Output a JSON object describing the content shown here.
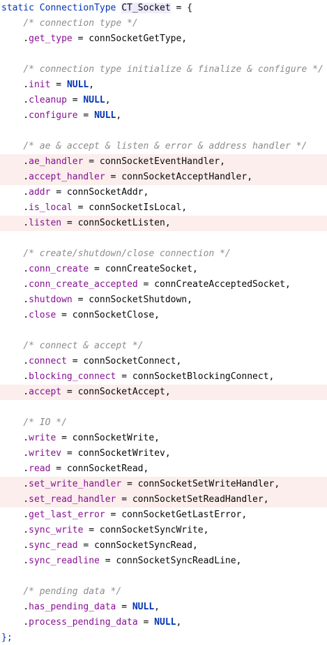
{
  "colors": {
    "background": "#ffffff",
    "highlight_line": "#fbeeec",
    "keyword": "#0033b3",
    "comment": "#8c8c8c",
    "field": "#871094",
    "text": "#080808"
  },
  "lines": [
    {
      "hl": false,
      "tokens": [
        {
          "t": "static ",
          "c": "kw"
        },
        {
          "t": "ConnectionType ",
          "c": "kw"
        },
        {
          "t": "CT_Socket",
          "c": "hl-word"
        },
        {
          "t": " = {",
          "c": "punct"
        }
      ]
    },
    {
      "hl": false,
      "tokens": [
        {
          "t": "    ",
          "c": "punct"
        },
        {
          "t": "/* connection type */",
          "c": "comment"
        }
      ]
    },
    {
      "hl": false,
      "tokens": [
        {
          "t": "    .",
          "c": "punct"
        },
        {
          "t": "get_type",
          "c": "field"
        },
        {
          "t": " = connSocketGetType,",
          "c": "ident"
        }
      ]
    },
    {
      "hl": false,
      "tokens": []
    },
    {
      "hl": false,
      "tokens": [
        {
          "t": "    ",
          "c": "punct"
        },
        {
          "t": "/* connection type initialize & finalize & configure */",
          "c": "comment"
        }
      ]
    },
    {
      "hl": false,
      "tokens": [
        {
          "t": "    .",
          "c": "punct"
        },
        {
          "t": "init",
          "c": "field"
        },
        {
          "t": " = ",
          "c": "ident"
        },
        {
          "t": "NULL",
          "c": "null-kw"
        },
        {
          "t": ",",
          "c": "punct"
        }
      ]
    },
    {
      "hl": false,
      "tokens": [
        {
          "t": "    .",
          "c": "punct"
        },
        {
          "t": "cleanup",
          "c": "field"
        },
        {
          "t": " = ",
          "c": "ident"
        },
        {
          "t": "NULL",
          "c": "null-kw"
        },
        {
          "t": ",",
          "c": "punct"
        }
      ]
    },
    {
      "hl": false,
      "tokens": [
        {
          "t": "    .",
          "c": "punct"
        },
        {
          "t": "configure",
          "c": "field"
        },
        {
          "t": " = ",
          "c": "ident"
        },
        {
          "t": "NULL",
          "c": "null-kw"
        },
        {
          "t": ",",
          "c": "punct"
        }
      ]
    },
    {
      "hl": false,
      "tokens": []
    },
    {
      "hl": false,
      "tokens": [
        {
          "t": "    ",
          "c": "punct"
        },
        {
          "t": "/* ae & accept & listen & error & address handler */",
          "c": "comment"
        }
      ]
    },
    {
      "hl": true,
      "tokens": [
        {
          "t": "    .",
          "c": "punct"
        },
        {
          "t": "ae_handler",
          "c": "field"
        },
        {
          "t": " = connSocketEventHandler,",
          "c": "ident"
        }
      ]
    },
    {
      "hl": true,
      "tokens": [
        {
          "t": "    .",
          "c": "punct"
        },
        {
          "t": "accept_handler",
          "c": "field"
        },
        {
          "t": " = connSocketAcceptHandler,",
          "c": "ident"
        }
      ]
    },
    {
      "hl": false,
      "tokens": [
        {
          "t": "    .",
          "c": "punct"
        },
        {
          "t": "addr",
          "c": "field"
        },
        {
          "t": " = connSocketAddr,",
          "c": "ident"
        }
      ]
    },
    {
      "hl": false,
      "tokens": [
        {
          "t": "    .",
          "c": "punct"
        },
        {
          "t": "is_local",
          "c": "field"
        },
        {
          "t": " = connSocketIsLocal,",
          "c": "ident"
        }
      ]
    },
    {
      "hl": true,
      "tokens": [
        {
          "t": "    .",
          "c": "punct"
        },
        {
          "t": "listen",
          "c": "field"
        },
        {
          "t": " = connSocketListen,",
          "c": "ident"
        }
      ]
    },
    {
      "hl": false,
      "tokens": []
    },
    {
      "hl": false,
      "tokens": [
        {
          "t": "    ",
          "c": "punct"
        },
        {
          "t": "/* create/shutdown/close connection */",
          "c": "comment"
        }
      ]
    },
    {
      "hl": false,
      "tokens": [
        {
          "t": "    .",
          "c": "punct"
        },
        {
          "t": "conn_create",
          "c": "field"
        },
        {
          "t": " = connCreateSocket,",
          "c": "ident"
        }
      ]
    },
    {
      "hl": false,
      "tokens": [
        {
          "t": "    .",
          "c": "punct"
        },
        {
          "t": "conn_create_accepted",
          "c": "field"
        },
        {
          "t": " = connCreateAcceptedSocket,",
          "c": "ident"
        }
      ]
    },
    {
      "hl": false,
      "tokens": [
        {
          "t": "    .",
          "c": "punct"
        },
        {
          "t": "shutdown",
          "c": "field"
        },
        {
          "t": " = connSocketShutdown,",
          "c": "ident"
        }
      ]
    },
    {
      "hl": false,
      "tokens": [
        {
          "t": "    .",
          "c": "punct"
        },
        {
          "t": "close",
          "c": "field"
        },
        {
          "t": " = connSocketClose,",
          "c": "ident"
        }
      ]
    },
    {
      "hl": false,
      "tokens": []
    },
    {
      "hl": false,
      "tokens": [
        {
          "t": "    ",
          "c": "punct"
        },
        {
          "t": "/* connect & accept */",
          "c": "comment"
        }
      ]
    },
    {
      "hl": false,
      "tokens": [
        {
          "t": "    .",
          "c": "punct"
        },
        {
          "t": "connect",
          "c": "field"
        },
        {
          "t": " = connSocketConnect,",
          "c": "ident"
        }
      ]
    },
    {
      "hl": false,
      "tokens": [
        {
          "t": "    .",
          "c": "punct"
        },
        {
          "t": "blocking_connect",
          "c": "field"
        },
        {
          "t": " = connSocketBlockingConnect,",
          "c": "ident"
        }
      ]
    },
    {
      "hl": true,
      "tokens": [
        {
          "t": "    .",
          "c": "punct"
        },
        {
          "t": "accept",
          "c": "field"
        },
        {
          "t": " = connSocketAccept,",
          "c": "ident"
        }
      ]
    },
    {
      "hl": false,
      "tokens": []
    },
    {
      "hl": false,
      "tokens": [
        {
          "t": "    ",
          "c": "punct"
        },
        {
          "t": "/* IO */",
          "c": "comment"
        }
      ]
    },
    {
      "hl": false,
      "tokens": [
        {
          "t": "    .",
          "c": "punct"
        },
        {
          "t": "write",
          "c": "field"
        },
        {
          "t": " = connSocketWrite,",
          "c": "ident"
        }
      ]
    },
    {
      "hl": false,
      "tokens": [
        {
          "t": "    .",
          "c": "punct"
        },
        {
          "t": "writev",
          "c": "field"
        },
        {
          "t": " = connSocketWritev,",
          "c": "ident"
        }
      ]
    },
    {
      "hl": false,
      "tokens": [
        {
          "t": "    .",
          "c": "punct"
        },
        {
          "t": "read",
          "c": "field"
        },
        {
          "t": " = connSocketRead,",
          "c": "ident"
        }
      ]
    },
    {
      "hl": true,
      "tokens": [
        {
          "t": "    .",
          "c": "punct"
        },
        {
          "t": "set_write_handler",
          "c": "field"
        },
        {
          "t": " = connSocketSetWriteHandler,",
          "c": "ident"
        }
      ]
    },
    {
      "hl": true,
      "tokens": [
        {
          "t": "    .",
          "c": "punct"
        },
        {
          "t": "set_read_handler",
          "c": "field"
        },
        {
          "t": " = connSocketSetReadHandler,",
          "c": "ident"
        }
      ]
    },
    {
      "hl": false,
      "tokens": [
        {
          "t": "    .",
          "c": "punct"
        },
        {
          "t": "get_last_error",
          "c": "field"
        },
        {
          "t": " = connSocketGetLastError,",
          "c": "ident"
        }
      ]
    },
    {
      "hl": false,
      "tokens": [
        {
          "t": "    .",
          "c": "punct"
        },
        {
          "t": "sync_write",
          "c": "field"
        },
        {
          "t": " = connSocketSyncWrite,",
          "c": "ident"
        }
      ]
    },
    {
      "hl": false,
      "tokens": [
        {
          "t": "    .",
          "c": "punct"
        },
        {
          "t": "sync_read",
          "c": "field"
        },
        {
          "t": " = connSocketSyncRead,",
          "c": "ident"
        }
      ]
    },
    {
      "hl": false,
      "tokens": [
        {
          "t": "    .",
          "c": "punct"
        },
        {
          "t": "sync_readline",
          "c": "field"
        },
        {
          "t": " = connSocketSyncReadLine,",
          "c": "ident"
        }
      ]
    },
    {
      "hl": false,
      "tokens": []
    },
    {
      "hl": false,
      "tokens": [
        {
          "t": "    ",
          "c": "punct"
        },
        {
          "t": "/* pending data */",
          "c": "comment"
        }
      ]
    },
    {
      "hl": false,
      "tokens": [
        {
          "t": "    .",
          "c": "punct"
        },
        {
          "t": "has_pending_data",
          "c": "field"
        },
        {
          "t": " = ",
          "c": "ident"
        },
        {
          "t": "NULL",
          "c": "null-kw"
        },
        {
          "t": ",",
          "c": "punct"
        }
      ]
    },
    {
      "hl": false,
      "tokens": [
        {
          "t": "    .",
          "c": "punct"
        },
        {
          "t": "process_pending_data",
          "c": "field"
        },
        {
          "t": " = ",
          "c": "ident"
        },
        {
          "t": "NULL",
          "c": "null-kw"
        },
        {
          "t": ",",
          "c": "punct"
        }
      ]
    },
    {
      "hl": false,
      "tokens": [
        {
          "t": "};",
          "c": "kw"
        }
      ]
    }
  ]
}
